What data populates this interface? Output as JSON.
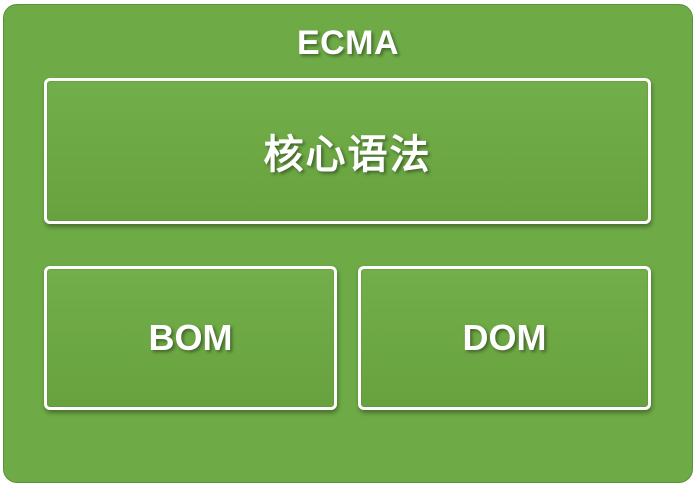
{
  "diagram": {
    "outer_label": "ECMA",
    "boxes": [
      {
        "label": "核心语法"
      },
      {
        "label": "BOM"
      },
      {
        "label": "DOM"
      }
    ],
    "colors": {
      "fill": "#6eab46",
      "box_border": "#ffffff",
      "text": "#ffffff"
    }
  }
}
